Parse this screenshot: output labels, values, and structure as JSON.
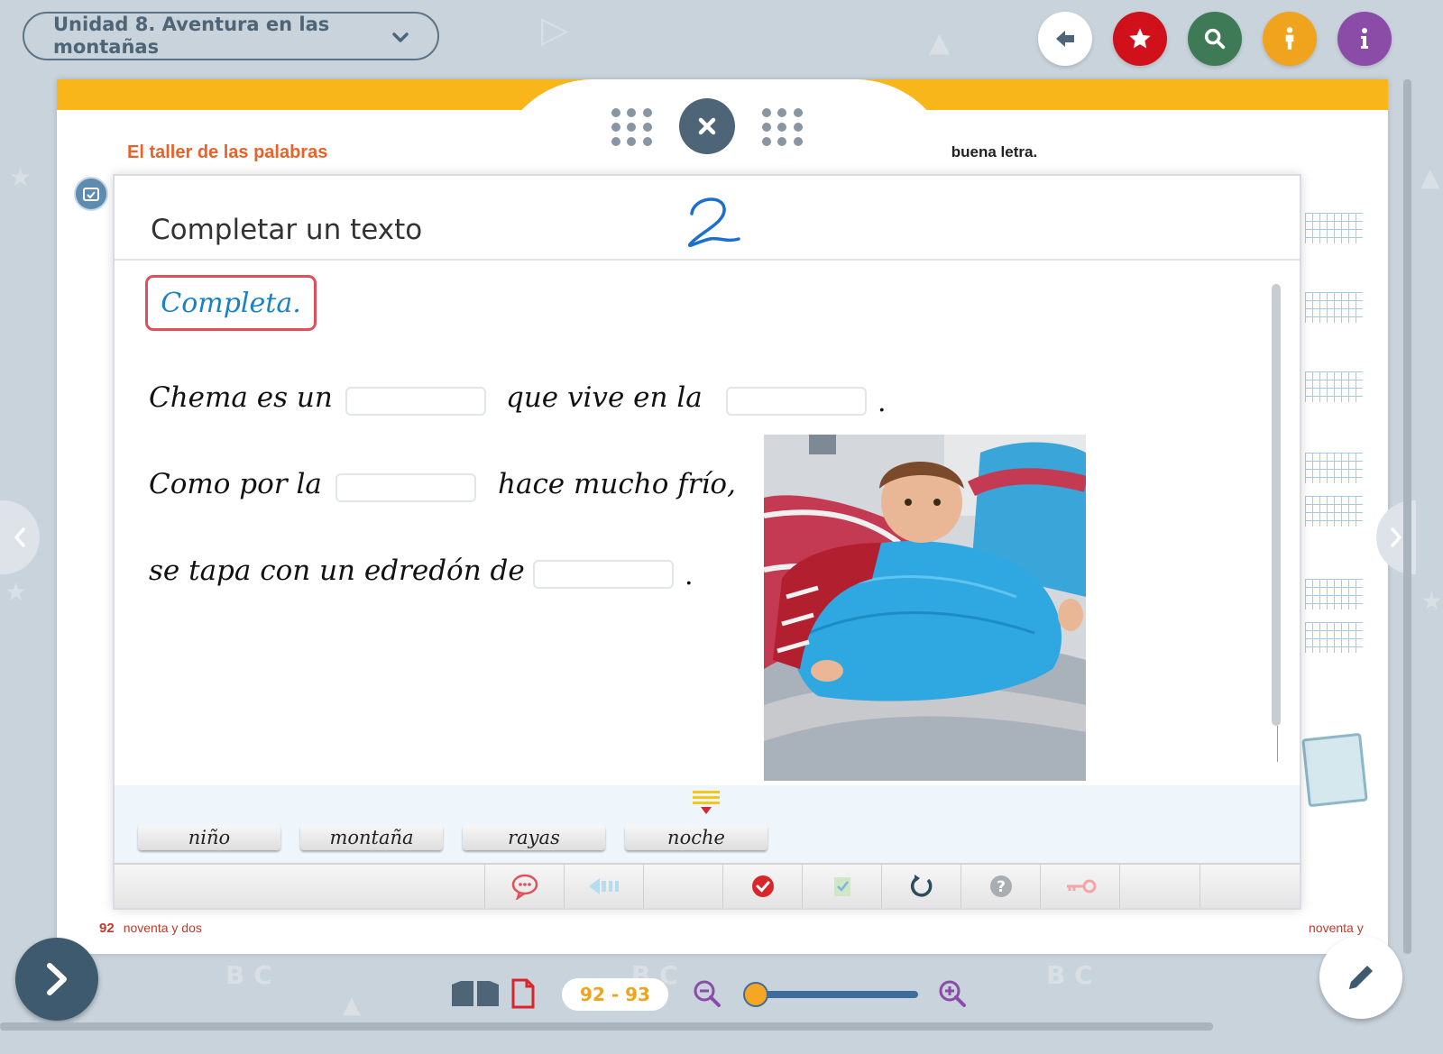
{
  "header": {
    "unit_title": "Unidad 8. Aventura en las montañas"
  },
  "top_buttons": [
    {
      "name": "back",
      "color": "#ffffff",
      "icon": "arrow-left-icon"
    },
    {
      "name": "favorites",
      "color": "#d0111b",
      "icon": "star-icon"
    },
    {
      "name": "search",
      "color": "#3f7a57",
      "icon": "search-icon"
    },
    {
      "name": "accessibility",
      "color": "#f0a31c",
      "icon": "person-icon"
    },
    {
      "name": "info",
      "color": "#8b4ca8",
      "icon": "info-icon"
    }
  ],
  "page": {
    "section_title": "El taller de las palabras",
    "right_instruction": "scribe con buena letra.",
    "left_page_number": "92",
    "left_page_words": "noventa y dos",
    "right_page_words": "noventa y"
  },
  "activity": {
    "title": "Completar un texto",
    "number": "2",
    "instruction": "Completa.",
    "sentence1": {
      "part1": "Chema es un",
      "part2": "que vive en la",
      "end": "."
    },
    "sentence2": {
      "part1": "Como por la",
      "part2": "hace mucho frío,"
    },
    "sentence3": {
      "part1": "se tapa con un edredón de",
      "end": "."
    },
    "word_bank": [
      "niño",
      "montaña",
      "rayas",
      "noche"
    ]
  },
  "toolbar": {
    "tools": [
      "speech-bubble-icon",
      "audio-back-icon",
      "blank",
      "check-icon",
      "clipboard-check-icon",
      "refresh-icon",
      "help-icon",
      "key-icon"
    ]
  },
  "navigation": {
    "page_range": "92 - 93",
    "zoom_level": 0.0
  },
  "colors": {
    "accent_orange": "#f8b61a",
    "section_orange": "#e8622a",
    "instruction_red": "#e0505a",
    "script_blue": "#1a82c4",
    "nav_dark": "#3d5a6e"
  }
}
